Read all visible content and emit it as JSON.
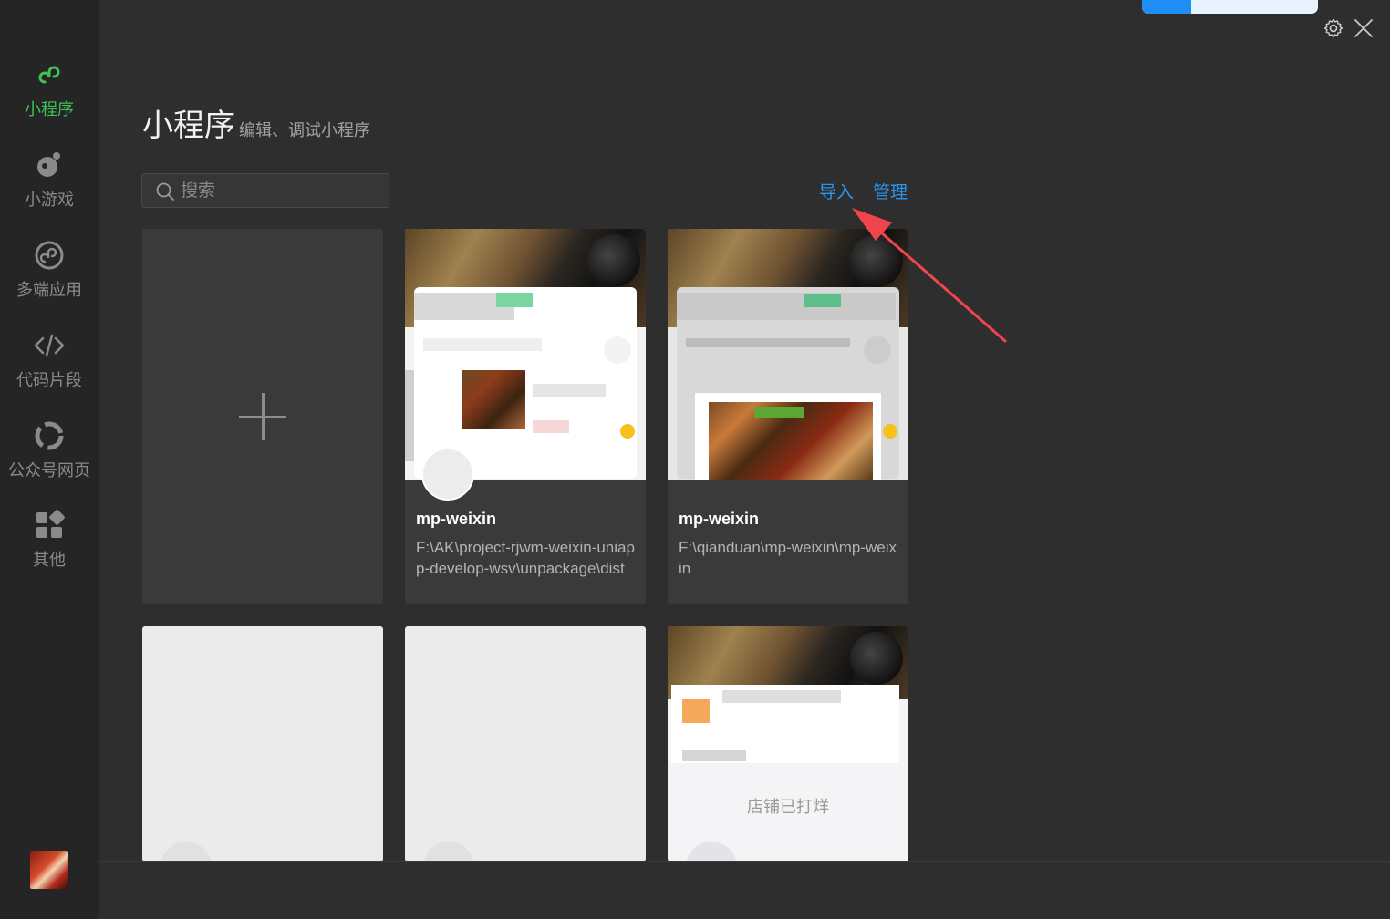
{
  "sidebar": {
    "items": [
      {
        "label": "小程序",
        "icon": "mini-program-icon",
        "active": true
      },
      {
        "label": "小游戏",
        "icon": "mini-game-icon",
        "active": false
      },
      {
        "label": "多端应用",
        "icon": "multi-platform-icon",
        "active": false
      },
      {
        "label": "代码片段",
        "icon": "code-icon",
        "active": false
      },
      {
        "label": "公众号网页",
        "icon": "official-account-icon",
        "active": false
      },
      {
        "label": "其他",
        "icon": "grid-icon",
        "active": false
      }
    ],
    "avatar": "user-avatar"
  },
  "top": {
    "progress": 0.28,
    "accent": "#1f8ff5"
  },
  "header": {
    "title": "小程序",
    "subtitle": "编辑、调试小程序"
  },
  "search": {
    "placeholder": "搜索",
    "value": ""
  },
  "actions": {
    "import_label": "导入",
    "manage_label": "管理",
    "link_color": "#2c95f2"
  },
  "projects": [
    {
      "name": "mp-weixin",
      "path": "F:\\AK\\project-rjwm-weixin-uniapp-develop-wsv\\unpackage\\dist\\dev\\mp-weixin"
    },
    {
      "name": "mp-weixin",
      "path": "F:\\qianduan\\mp-weixin\\mp-weixin"
    }
  ],
  "placeholder_cards": {
    "shop_status": "店铺已打烊"
  },
  "colors": {
    "active": "#3fc257",
    "annotation_arrow": "#f0464b"
  }
}
